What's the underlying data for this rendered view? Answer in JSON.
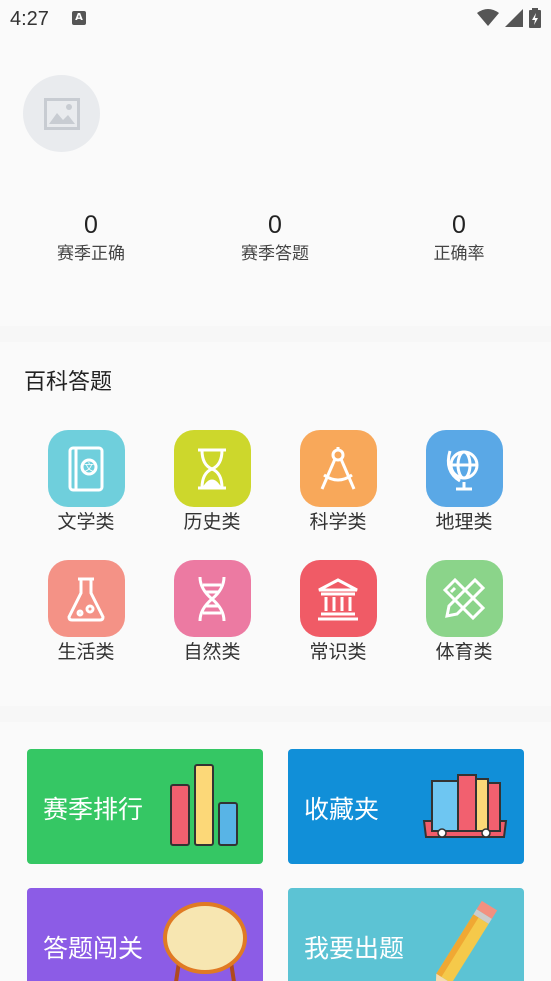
{
  "status_bar": {
    "time": "4:27",
    "notif_letter": "A"
  },
  "profile": {
    "stats": [
      {
        "value": "0",
        "label": "赛季正确"
      },
      {
        "value": "0",
        "label": "赛季答题"
      },
      {
        "value": "0",
        "label": "正确率"
      }
    ]
  },
  "encyclopedia": {
    "title": "百科答题",
    "categories": [
      {
        "label": "文学类",
        "icon": "book-icon",
        "color": "#6fcfdc"
      },
      {
        "label": "历史类",
        "icon": "hourglass-icon",
        "color": "#cdd72c"
      },
      {
        "label": "科学类",
        "icon": "compass-icon",
        "color": "#f8a85a"
      },
      {
        "label": "地理类",
        "icon": "globe-icon",
        "color": "#5aa8e6"
      },
      {
        "label": "生活类",
        "icon": "flask-icon",
        "color": "#f49286"
      },
      {
        "label": "自然类",
        "icon": "dna-icon",
        "color": "#ec7aa2"
      },
      {
        "label": "常识类",
        "icon": "bank-icon",
        "color": "#f05b66"
      },
      {
        "label": "体育类",
        "icon": "ruler-pencil-icon",
        "color": "#8bd48a"
      }
    ]
  },
  "cards": [
    {
      "label": "赛季排行",
      "color": "#35c764",
      "icon": "bar-chart-icon"
    },
    {
      "label": "收藏夹",
      "color": "#118fd8",
      "icon": "books-icon"
    },
    {
      "label": "答题闯关",
      "color": "#8c5ce6",
      "icon": "drum-icon"
    },
    {
      "label": "我要出题",
      "color": "#5cc3d4",
      "icon": "pencil-icon"
    }
  ]
}
